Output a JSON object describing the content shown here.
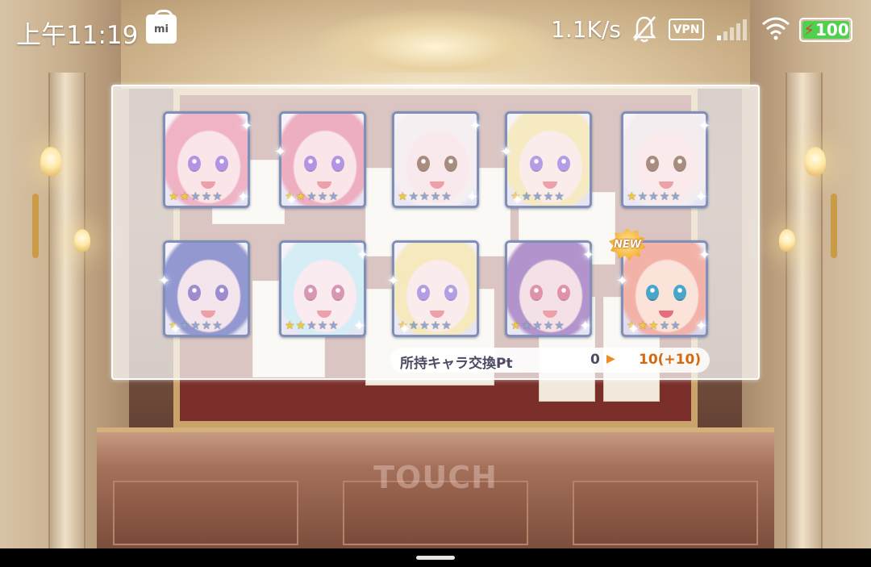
{
  "status_bar": {
    "time": "上午11:19",
    "mi_label": "mi",
    "net_speed": "1.1K/s",
    "vpn": "VPN",
    "battery": "100",
    "battery_level": 1.0
  },
  "touch_prompt": "TOUCH",
  "new_badge": "NEW",
  "exchange": {
    "label": "所持キャラ交換Pt",
    "current": "0",
    "new": "10(+10)"
  },
  "cards": [
    {
      "stars": 2,
      "max": 5,
      "hair": "#e88aa8",
      "face": "#f7d7dc",
      "eye": "#8b5ad6",
      "new": false
    },
    {
      "stars": 2,
      "max": 5,
      "hair": "#e4849f",
      "face": "#f7d7dc",
      "eye": "#8b5ad6",
      "new": false
    },
    {
      "stars": 1,
      "max": 5,
      "hair": "#f1e6ea",
      "face": "#f8dde2",
      "eye": "#7a4f3a",
      "new": false
    },
    {
      "stars": 1,
      "max": 5,
      "hair": "#f1dfa2",
      "face": "#f8e2e0",
      "eye": "#8a6ad8",
      "new": false
    },
    {
      "stars": 1,
      "max": 5,
      "hair": "#efe3e6",
      "face": "#f7dfe2",
      "eye": "#7a4f3a",
      "new": false
    },
    {
      "stars": 1,
      "max": 5,
      "hair": "#5a62b8",
      "face": "#eed6e2",
      "eye": "#6a4fb8",
      "new": false
    },
    {
      "stars": 2,
      "max": 5,
      "hair": "#bfe3f0",
      "face": "#f6e0e6",
      "eye": "#c2608a",
      "new": false
    },
    {
      "stars": 1,
      "max": 5,
      "hair": "#f0dd9a",
      "face": "#f7e0e2",
      "eye": "#8a6ad8",
      "new": false
    },
    {
      "stars": 1,
      "max": 5,
      "hair": "#8a5ab0",
      "face": "#efd2dc",
      "eye": "#d05a7a",
      "new": false
    },
    {
      "stars": 3,
      "max": 5,
      "hair": "#f3b2a8",
      "face": "#fbe3da",
      "eye": "#4aa6c8",
      "new": true
    }
  ],
  "colors": {
    "accent_orange": "#f08a20",
    "card_border": "#7f8fb8",
    "star_on": "#f2c93a",
    "star_off": "#8fa6d6"
  }
}
